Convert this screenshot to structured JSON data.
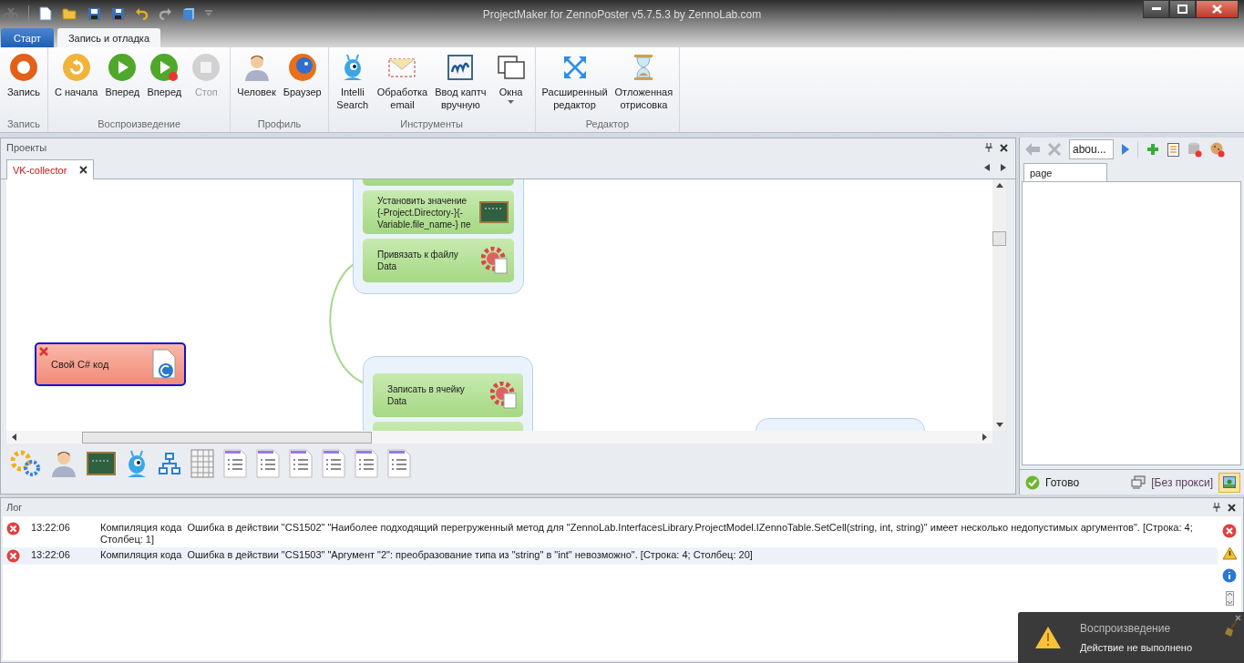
{
  "window": {
    "title": "ProjectMaker for ZennoPoster v5.7.5.3 by ZennoLab.com"
  },
  "ribbon_tabs": [
    {
      "label": "Старт",
      "selected": false
    },
    {
      "label": "Запись и отладка",
      "selected": true
    }
  ],
  "ribbon_groups": [
    {
      "label": "Запись",
      "buttons": [
        {
          "label": "Запись",
          "disabled": false
        }
      ]
    },
    {
      "label": "Воспроизведение",
      "buttons": [
        {
          "label": "С начала",
          "disabled": false
        },
        {
          "label": "Вперед",
          "disabled": false
        },
        {
          "label": "Вперед",
          "disabled": false
        },
        {
          "label": "Стоп",
          "disabled": true
        }
      ]
    },
    {
      "label": "Профиль",
      "buttons": [
        {
          "label": "Человек",
          "disabled": false
        },
        {
          "label": "Браузер",
          "disabled": false
        }
      ]
    },
    {
      "label": "Инструменты",
      "buttons": [
        {
          "label": "Intelli\nSearch",
          "disabled": false
        },
        {
          "label": "Обработка\nemail",
          "disabled": false
        },
        {
          "label": "Ввод каптч\nвручную",
          "disabled": false
        },
        {
          "label": "Окна",
          "disabled": false
        }
      ]
    },
    {
      "label": "Редактор",
      "buttons": [
        {
          "label": "Расширенный\nредактор",
          "disabled": false
        },
        {
          "label": "Отложенная\nотрисовка",
          "disabled": false
        }
      ]
    }
  ],
  "projects_panel": {
    "title": "Проекты",
    "tabs": [
      {
        "label": "VK-collector",
        "selected": true
      }
    ],
    "canvas": {
      "groups": [
        {
          "nodes": [
            {
              "text": "Установить значение {-Project.Directory-}{-Variable.file_name-} пе"
            },
            {
              "text": "Привязать к файлу Data"
            }
          ]
        },
        {
          "nodes": [
            {
              "text": "Записать в ячейку Data"
            }
          ]
        }
      ],
      "nodes": [
        {
          "text": "Свой C# код",
          "error": true,
          "selected": true
        }
      ]
    }
  },
  "browser_panel": {
    "address": "abou...",
    "tabs": [
      {
        "label": "page"
      }
    ],
    "status": "Готово",
    "proxy": "[Без прокси]"
  },
  "log": {
    "title": "Лог",
    "entries": [
      {
        "kind": "error",
        "time": "13:22:06",
        "source": "Компиляция кода",
        "message": "Ошибка в действии \"CS1502\" \"Наиболее подходящий перегруженный метод для \"ZennoLab.InterfacesLibrary.ProjectModel.IZennoTable.SetCell(string, int, string)\" имеет несколько недопустимых аргументов\". [Строка: 4; Столбец: 1]"
      },
      {
        "kind": "error",
        "time": "13:22:06",
        "source": "Компиляция кода",
        "message": "Ошибка в действии \"CS1503\" \"Аргумент \"2\": преобразование типа из \"string\" в \"int\" невозможно\". [Строка: 4; Столбец: 20]"
      }
    ]
  },
  "toast": {
    "title": "Воспроизведение",
    "message": "Действие не выполнено"
  }
}
